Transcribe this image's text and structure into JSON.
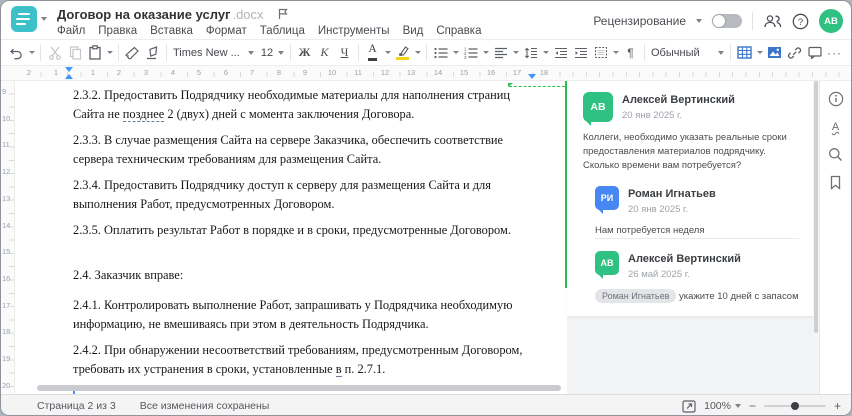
{
  "window": {
    "title": "Договор на оказание услуг",
    "title_ext": ".docx"
  },
  "menu": {
    "items": [
      "Файл",
      "Правка",
      "Вставка",
      "Формат",
      "Таблица",
      "Инструменты",
      "Вид",
      "Справка"
    ]
  },
  "header_right": {
    "review_label": "Рецензирование",
    "review_toggle_state": "off",
    "avatar_initials": "АВ"
  },
  "toolbar": {
    "font_name": "Times New ...",
    "font_size": "12",
    "bold_label": "Ж",
    "italic_label": "К",
    "underline_label": "Ч",
    "font_color_label": "А",
    "style_name": "Обычный",
    "pilcrow": "¶",
    "more_label": "···",
    "highlight_color": "#f2d21f",
    "accent_icon_color": "#3c76c9",
    "icons": [
      "undo-icon",
      "cut-icon",
      "copy-icon",
      "paste-icon",
      "format-painter-icon",
      "clear-style-icon",
      "bullet-list-icon",
      "numbered-list-icon",
      "align-left-icon",
      "line-spacing-icon",
      "decrease-indent-icon",
      "increase-indent-icon",
      "paragraph-border-icon",
      "table-icon",
      "image-icon",
      "link-icon",
      "comment-icon"
    ]
  },
  "ruler": {
    "h_left": [
      "2",
      "1"
    ],
    "h_right": [
      "1",
      "2",
      "3",
      "4",
      "5",
      "6",
      "7",
      "8",
      "9",
      "10",
      "11",
      "12",
      "13",
      "14",
      "15",
      "16",
      "17",
      "18"
    ],
    "v": [
      "9",
      "10",
      "11",
      "12",
      "13",
      "14",
      "15",
      "16",
      "17",
      "18",
      "19",
      "20"
    ]
  },
  "document": {
    "p1_before": "2.3.2. Предоставить Подрядчику необходимые материалы для наполнения страниц Сайта не ",
    "p1_marked": "позднее",
    "p1_after": " 2 (двух) дней с момента заключения Договора.",
    "p2": "2.3.3. В случае размещения Сайта на сервере Заказчика, обеспечить соответствие сервера техническим требованиям для размещения Сайта.",
    "p3": "2.3.4. Предоставить Подрядчику доступ к серверу для размещения Сайта и для выполнения Работ, предусмотренных Договором.",
    "p4": "2.3.5. Оплатить результат Работ в порядке и в сроки, предусмотренные Договором.",
    "p5": "2.4. Заказчик вправе:",
    "p6": "2.4.1. Контролировать выполнение Работ, запрашивать у Подрядчика необходимую информацию, не вмешиваясь при этом в деятельность Подрядчика.",
    "p7_before": "2.4.2. При обнаружении несоответствий требованиям, предусмотренным Договором, требовать их устранения в сроки, установленные ",
    "p7_marked": "в",
    "p7_after": " п. 2.7.1."
  },
  "comments": {
    "accent_color": "#2bbf4e",
    "main": {
      "initials": "АВ",
      "name": "Алексей Вертинский",
      "date": "20 янв 2025 г.",
      "text": "Коллеги, необходимо указать реальные сроки предоставления материалов подрядчику. Сколько времени вам потребуется?",
      "avatar_color": "#2fc181"
    },
    "reply1": {
      "initials": "РИ",
      "name": "Роман Игнатьев",
      "date": "20 янв 2025 г.",
      "text": "Нам потребуется неделя",
      "avatar_color": "#4687f4"
    },
    "reply2": {
      "initials": "АВ",
      "name": "Алексей Вертинский",
      "date": "26 май 2025 г.",
      "mention": "Роман Игнатьев",
      "text": " укажите 10 дней с запасом",
      "avatar_color": "#2fc181"
    }
  },
  "right_strip": {
    "icons": [
      "info-icon",
      "spellcheck-icon",
      "search-icon",
      "bookmark-icon"
    ],
    "spell_glyph": "А"
  },
  "statusbar": {
    "page": "Страница 2 из 3",
    "saved": "Все изменения сохранены",
    "zoom": "100%",
    "zoom_out": "−",
    "zoom_in": "+"
  }
}
